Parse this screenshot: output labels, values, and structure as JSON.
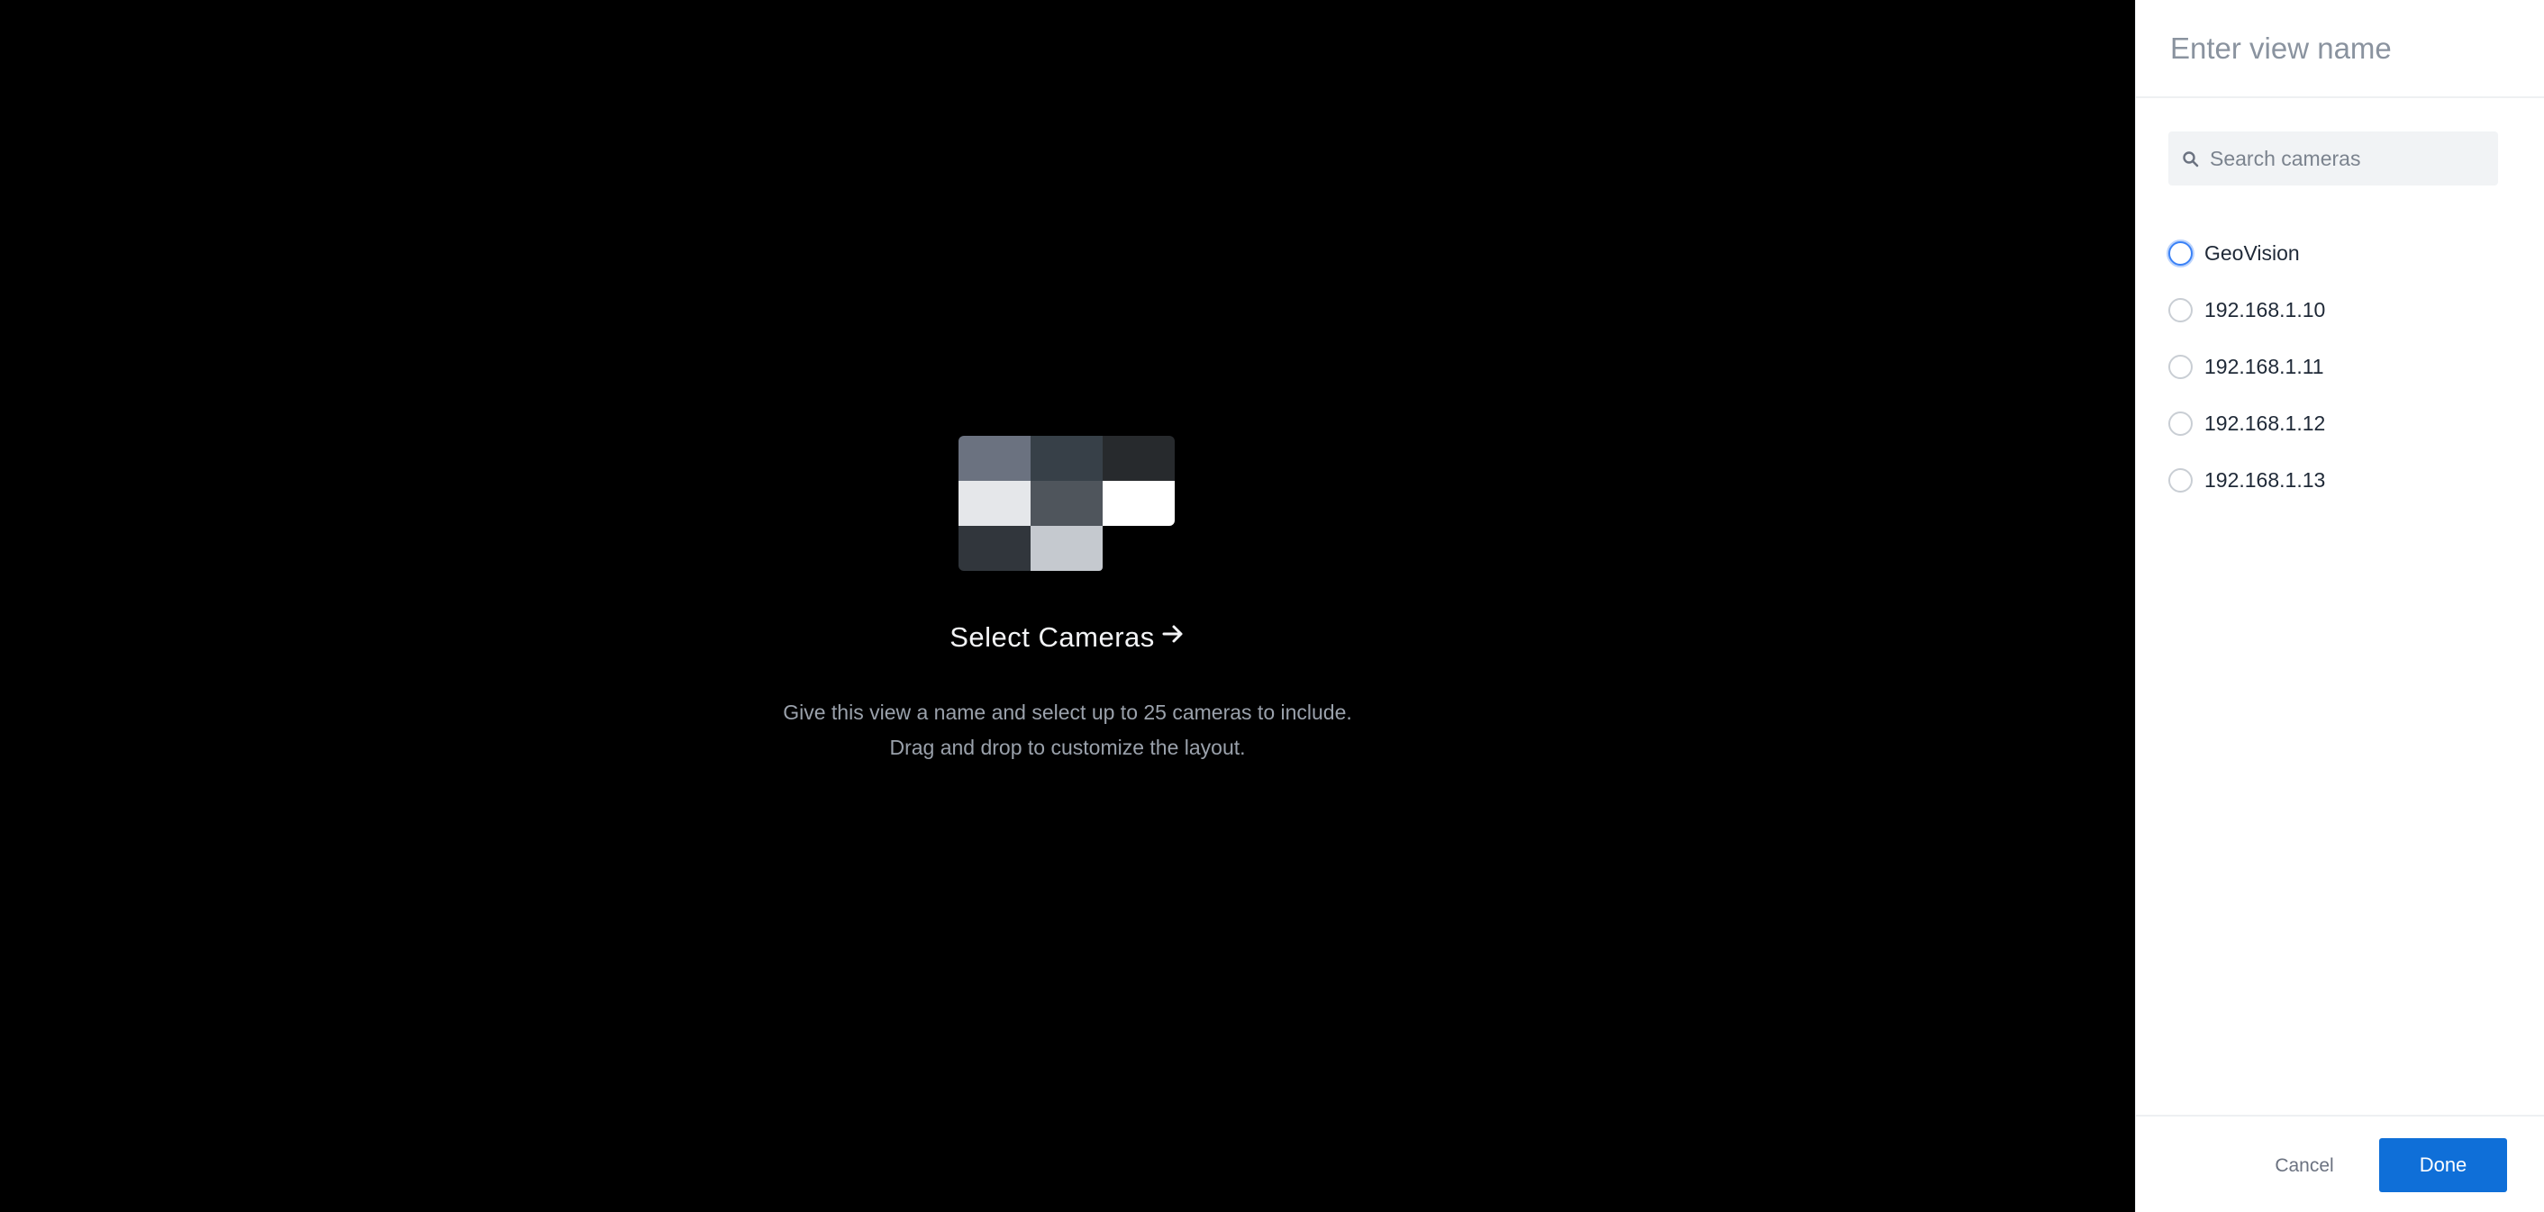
{
  "panel": {
    "view_name_placeholder": "Enter view name",
    "view_name_value": "",
    "search": {
      "placeholder": "Search cameras",
      "icon": "search-icon"
    },
    "cameras": [
      {
        "label": "GeoVision",
        "selected": false,
        "focused": true
      },
      {
        "label": "192.168.1.10",
        "selected": false,
        "focused": false
      },
      {
        "label": "192.168.1.11",
        "selected": false,
        "focused": false
      },
      {
        "label": "192.168.1.12",
        "selected": false,
        "focused": false
      },
      {
        "label": "192.168.1.13",
        "selected": false,
        "focused": false
      }
    ],
    "footer": {
      "cancel_label": "Cancel",
      "done_label": "Done"
    }
  },
  "empty_state": {
    "icon": "camera-grid-icon",
    "title": "Select Cameras",
    "title_icon": "arrow-right-icon",
    "description_line1": "Give this view a name and select up to 25 cameras to include.",
    "description_line2": "Drag and drop to customize the layout."
  },
  "colors": {
    "background": "#000000",
    "panel": "#ffffff",
    "accent": "#0f6fd8",
    "focus_ring": "#3b82f6"
  }
}
